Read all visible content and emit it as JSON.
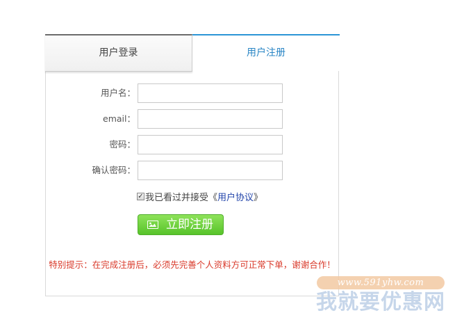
{
  "tabs": {
    "login": "用户登录",
    "register": "用户注册"
  },
  "form": {
    "username_label": "用户名：",
    "email_label": "email：",
    "password_label": "密码：",
    "confirm_label": "确认密码：",
    "username_value": "",
    "email_value": "",
    "password_value": "",
    "confirm_value": ""
  },
  "agreement": {
    "checked": true,
    "text": "我已看过并接受",
    "open_quote": "《",
    "link": "用户协议",
    "close_quote": "》"
  },
  "submit_label": "立即注册",
  "notice": "特别提示：在完成注册后，必须先完善个人资料方可正常下单，谢谢合作！",
  "watermark": {
    "url": "www.591yhw.com",
    "name": "我就要优惠网"
  },
  "colors": {
    "accent": "#2b95d6",
    "submit": "#57c32a",
    "notice": "#d93a2b",
    "link": "#2244aa"
  }
}
